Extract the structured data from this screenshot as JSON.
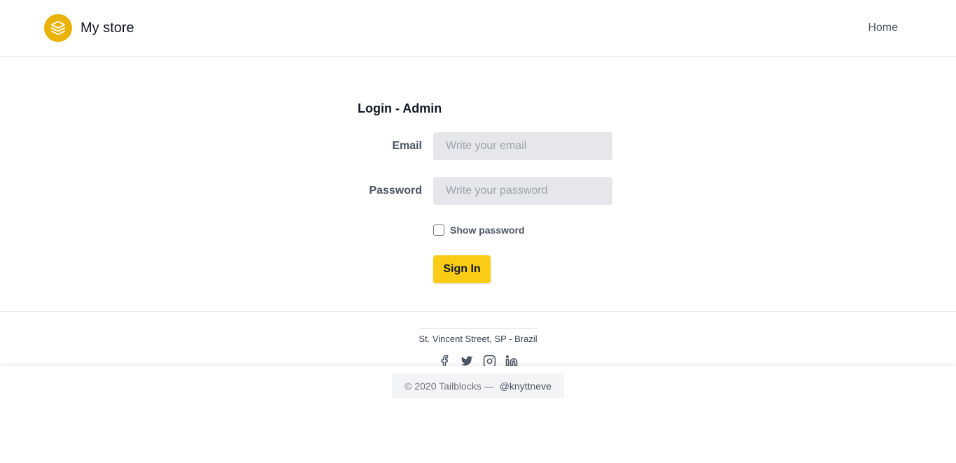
{
  "header": {
    "brand_name": "My store",
    "logo_icon": "layers-icon",
    "nav": {
      "home_label": "Home"
    }
  },
  "login": {
    "title": "Login - Admin",
    "email": {
      "label": "Email",
      "placeholder": "Write your email",
      "value": ""
    },
    "password": {
      "label": "Password",
      "placeholder": "Write your password",
      "value": ""
    },
    "show_password": {
      "label": "Show password",
      "checked": false
    },
    "submit_label": "Sign In"
  },
  "footer": {
    "address": "St. Vincent Street, SP - Brazil",
    "social": [
      "facebook-icon",
      "twitter-icon",
      "instagram-icon",
      "linkedin-icon"
    ],
    "copyright": "© 2020 Tailblocks —",
    "handle": "@knyttneve"
  },
  "colors": {
    "accent": "#facc15",
    "logo_bg": "#eab308",
    "input_bg": "#e5e7eb",
    "text_muted": "#4b5563"
  }
}
